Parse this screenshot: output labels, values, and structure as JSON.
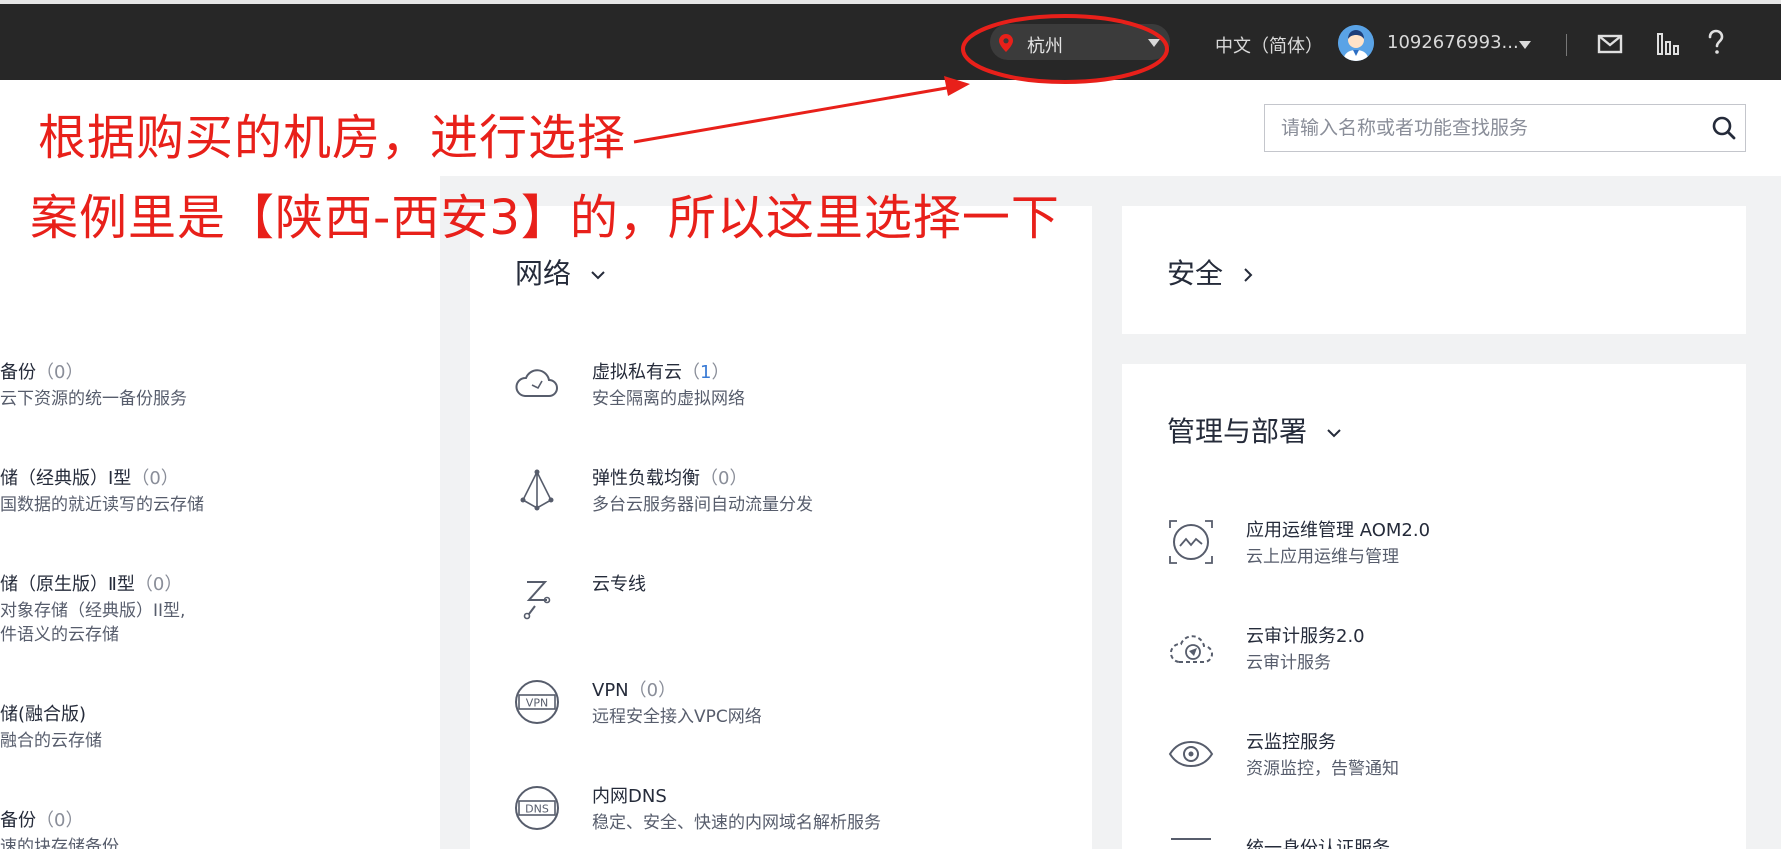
{
  "header": {
    "region": "杭州",
    "language": "中文（简体）",
    "user_id": "1092676993..."
  },
  "search": {
    "placeholder": "请输入名称或者功能查找服务"
  },
  "annotations": {
    "line1": "根据购买的机房，进行选择",
    "line2": "案例里是【陕西-西安3】的，所以这里选择一下",
    "color": "#e8201a"
  },
  "left_column": {
    "items": [
      {
        "name": "备份",
        "count": "0",
        "desc": "云下资源的统一备份服务"
      },
      {
        "name": "储（经典版）Ⅰ型",
        "count": "0",
        "desc": "国数据的就近读写的云存储"
      },
      {
        "name": "储（原生版）Ⅱ型",
        "count": "0",
        "desc": "对象存储（经典版）II型,",
        "desc2": "件语义的云存储"
      },
      {
        "name": "储(融合版)",
        "desc": "融合的云存储"
      },
      {
        "name": "备份",
        "count": "0",
        "desc": "速的块存储备份"
      }
    ]
  },
  "network": {
    "title": "网络",
    "items": [
      {
        "name": "虚拟私有云",
        "count": "1",
        "desc": "安全隔离的虚拟网络",
        "icon": "cloud-vpc-icon"
      },
      {
        "name": "弹性负载均衡",
        "count": "0",
        "desc": "多台云服务器间自动流量分发",
        "icon": "load-balancer-icon"
      },
      {
        "name": "云专线",
        "icon": "direct-connect-icon"
      },
      {
        "name": "VPN",
        "count": "0",
        "desc": "远程安全接入VPC网络",
        "icon": "vpn-icon",
        "icon_text": "VPN"
      },
      {
        "name": "内网DNS",
        "desc": "稳定、安全、快速的内网域名解析服务",
        "icon": "dns-icon",
        "icon_text": "DNS"
      }
    ]
  },
  "security": {
    "title": "安全"
  },
  "management": {
    "title": "管理与部署",
    "items": [
      {
        "name": "应用运维管理 AOM2.0",
        "desc": "云上应用运维与管理",
        "icon": "aom-icon"
      },
      {
        "name": "云审计服务2.0",
        "desc": "云审计服务",
        "icon": "cloud-audit-icon"
      },
      {
        "name": "云监控服务",
        "desc": "资源监控，告警通知",
        "icon": "monitor-eye-icon"
      },
      {
        "name": "统一身份认证服务",
        "icon": "iam-icon"
      }
    ]
  }
}
